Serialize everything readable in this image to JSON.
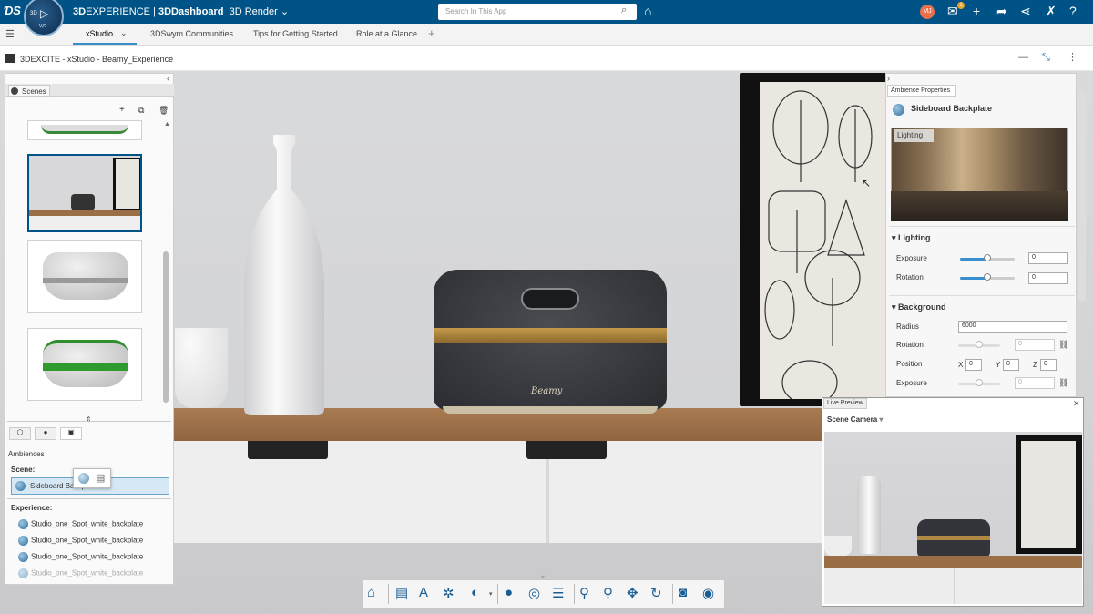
{
  "topbar": {
    "brand": "3D",
    "product": "EXPERIENCE",
    "app": "3DDashboard",
    "dashboard": "3D Render",
    "search_placeholder": "Search In This App",
    "compass_label": "V,R",
    "user_initials": "MJ",
    "notif_count": "1"
  },
  "tabs": [
    {
      "label": "xStudio"
    },
    {
      "label": "3DSwym Communities"
    },
    {
      "label": "Tips for Getting Started"
    },
    {
      "label": "Role at a Glance"
    }
  ],
  "subtitle": "3DEXCITE - xStudio - Beamy_Experience",
  "left_panel": {
    "tab_label": "Scenes",
    "ambiences_label": "Ambiences",
    "scene_label": "Scene:",
    "scene_item": "Sideboard Backplate",
    "experience_label": "Experience:",
    "experience_items": [
      "Studio_one_Spot_white_backplate",
      "Studio_one_Spot_white_backplate",
      "Studio_one_Spot_white_backplate",
      "Studio_one_Spot_white_backplate"
    ]
  },
  "right_panel": {
    "tab_label": "Ambience Properties",
    "title": "Sideboard Backplate",
    "hdri_label": "Lighting",
    "lighting_section": "Lighting",
    "exposure_label": "Exposure",
    "exposure_value": "0",
    "exposure_level": 0.5,
    "rotation_label": "Rotation",
    "rotation_value": "0",
    "rotation_level": 0.5,
    "background_section": "Background",
    "radius_label": "Radius",
    "radius_value": "6000",
    "bg_rotation_label": "Rotation",
    "bg_rotation_value": "0",
    "position_label": "Position",
    "pos_x_label": "X",
    "pos_x": "0",
    "pos_y_label": "Y",
    "pos_y": "0",
    "pos_z_label": "Z",
    "pos_z": "0",
    "bg_exposure_label": "Exposure",
    "bg_exposure_value": "0"
  },
  "live_preview": {
    "tab_label": "Live Preview",
    "camera": "Scene Camera"
  },
  "product_brand": "Beamy",
  "colors": {
    "topbar": "#005386",
    "accent": "#368ec4",
    "toolbar_icons": "#1a5d93"
  }
}
